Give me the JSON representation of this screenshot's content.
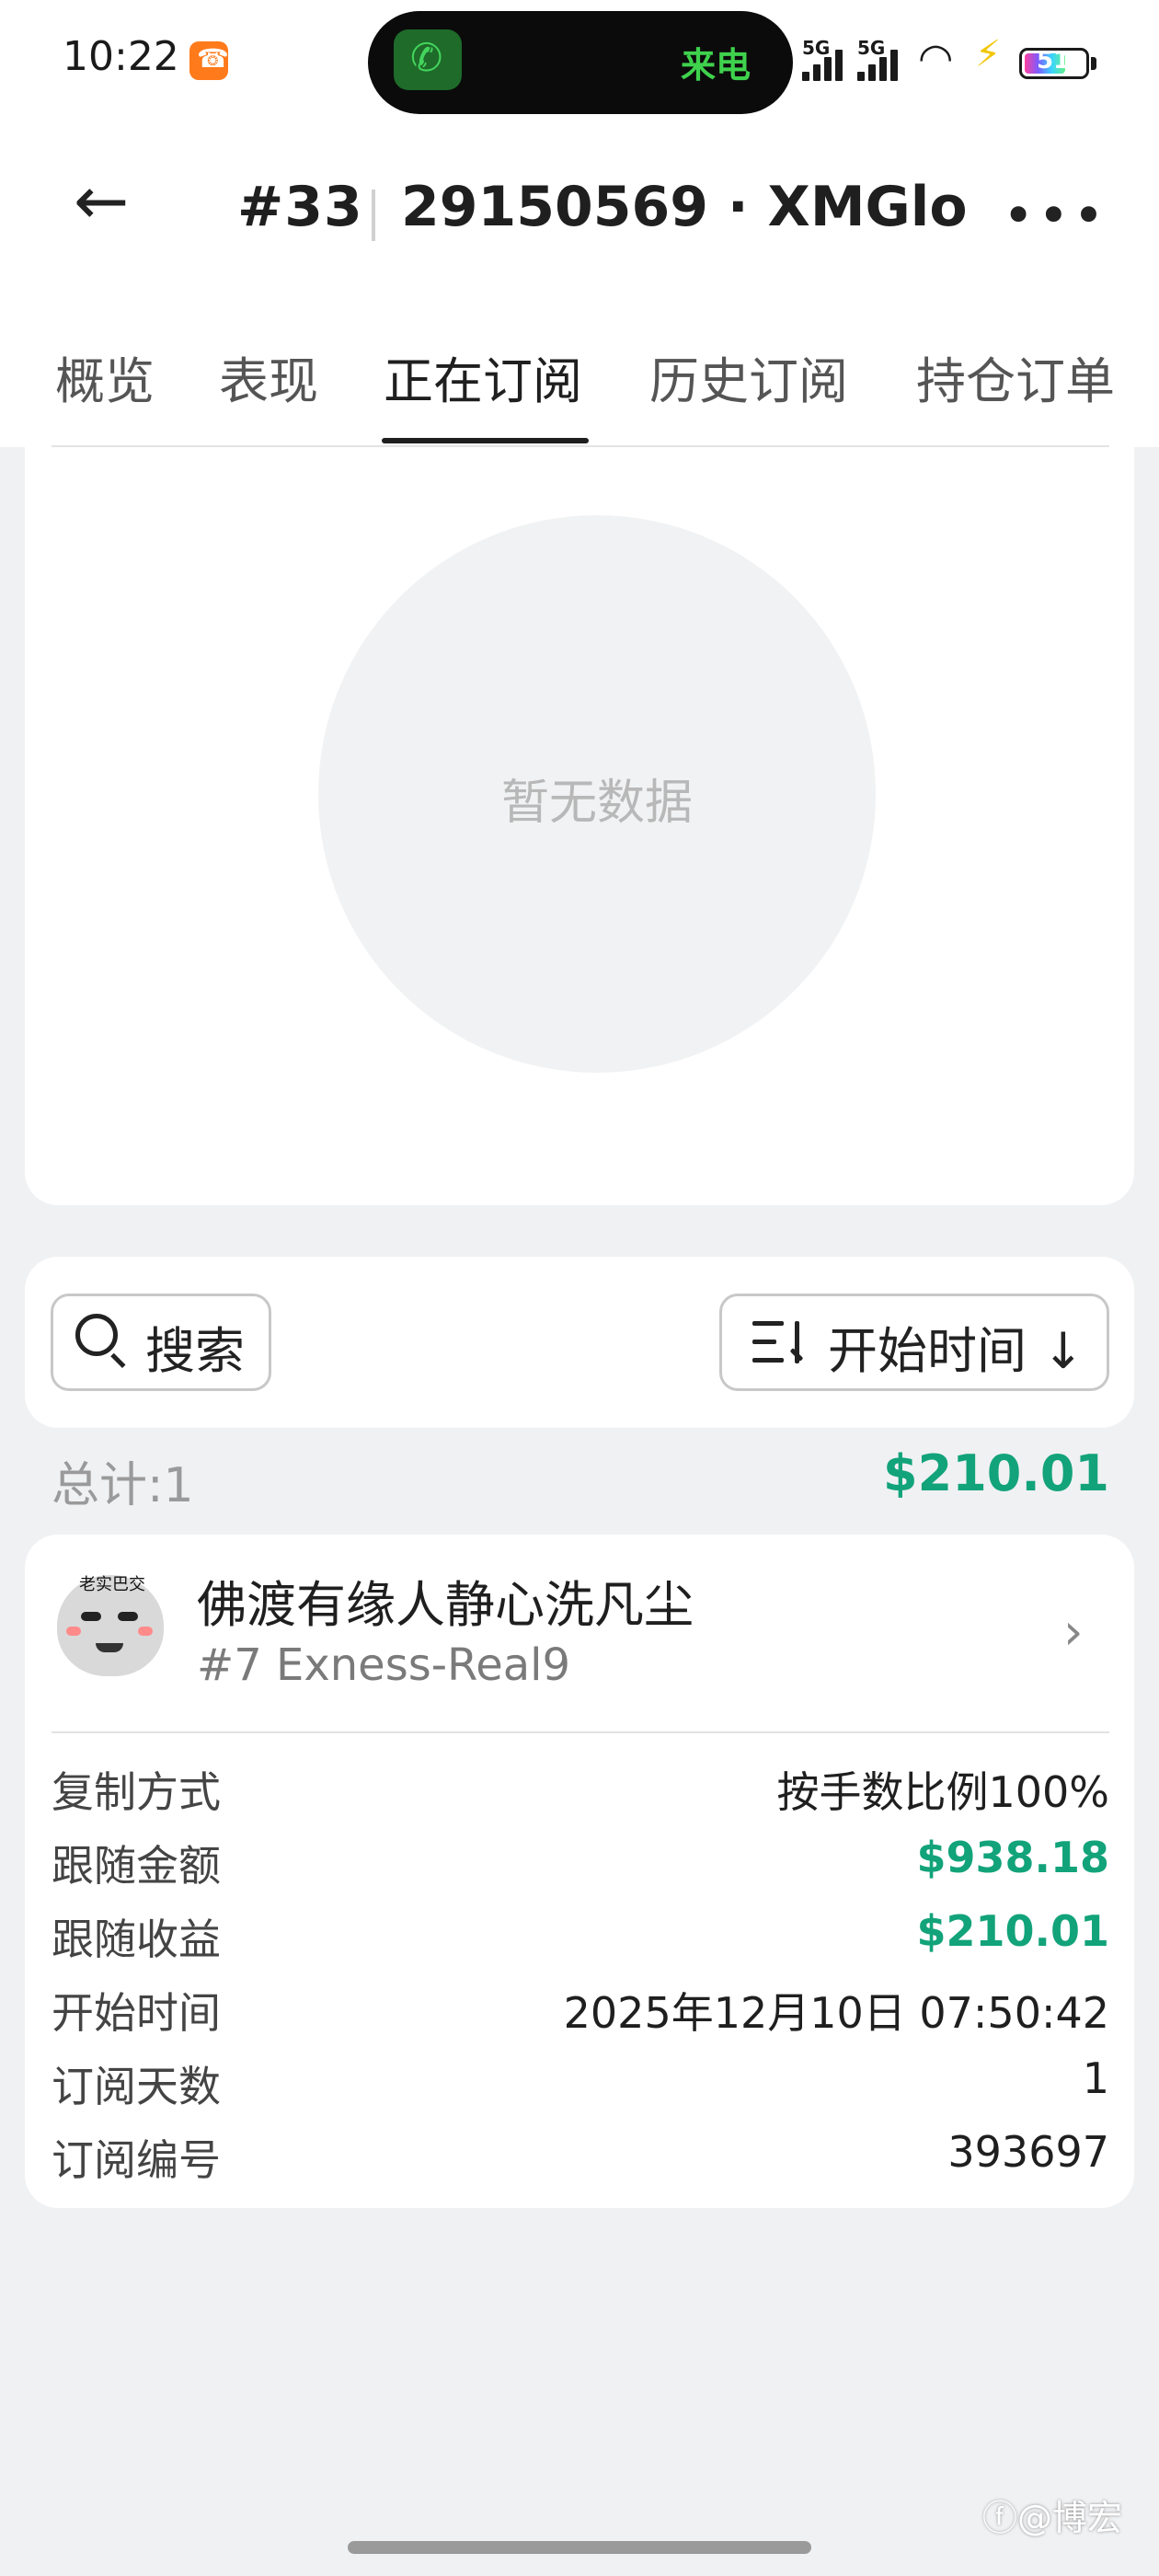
{
  "status_bar": {
    "time": "10:22",
    "call_label": "来电",
    "signal1": "5G",
    "signal2": "5G",
    "battery": "51"
  },
  "header": {
    "rank": "#33",
    "account": "29150569 · XMGlo...",
    "back_icon": "arrow-left-icon",
    "more_icon": "more-icon"
  },
  "tabs": [
    {
      "label": "概览",
      "active": false
    },
    {
      "label": "表现",
      "active": false
    },
    {
      "label": "正在订阅",
      "active": true
    },
    {
      "label": "历史订阅",
      "active": false
    },
    {
      "label": "持仓订单",
      "active": false
    }
  ],
  "chart": {
    "empty_text": "暂无数据"
  },
  "toolbar": {
    "search_label": "搜索",
    "sort_label": "开始时间 ↓"
  },
  "summary": {
    "total_label": "总计:1",
    "total_value": "$210.01"
  },
  "subscription": {
    "avatar_text": "老实巴交",
    "trader_name": "佛渡有缘人静心洗凡尘",
    "trader_account": "#7 Exness-Real9",
    "rows": [
      {
        "label": "复制方式",
        "value": "按手数比例100%"
      },
      {
        "label": "跟随金额",
        "value": "$938.18"
      },
      {
        "label": "跟随收益",
        "value": "$210.01"
      },
      {
        "label": "开始时间",
        "value": "2025年12月10日 07:50:42"
      },
      {
        "label": "订阅天数",
        "value": "1"
      },
      {
        "label": "订阅编号",
        "value": "393697"
      }
    ]
  },
  "watermark": "ⓕ@博宏",
  "colors": {
    "accent_green": "#12a37a",
    "background": "#f0f1f3",
    "card": "#ffffff"
  }
}
